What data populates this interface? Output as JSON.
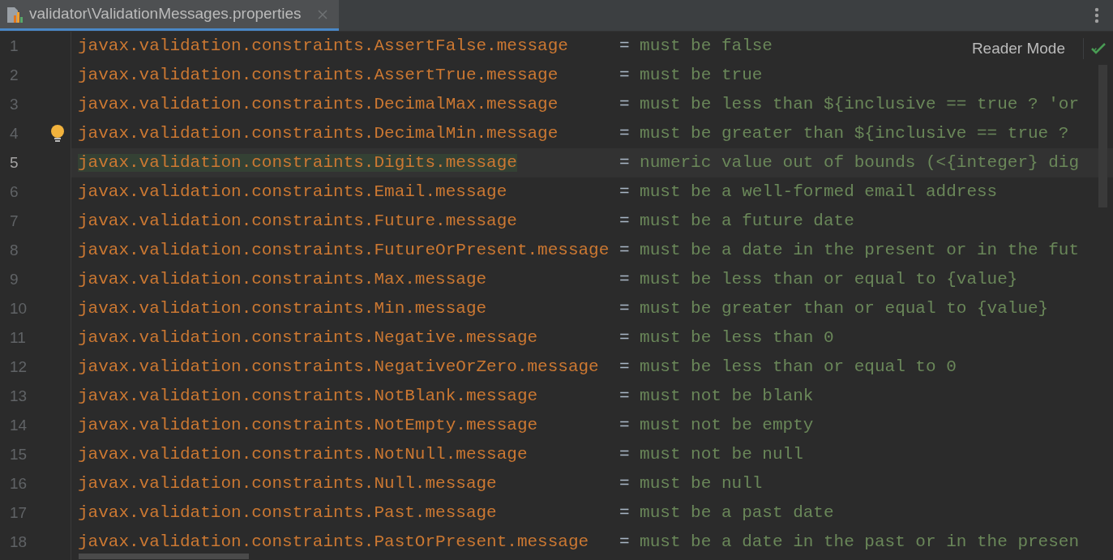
{
  "tab": {
    "title": "validator\\ValidationMessages.properties",
    "selected": true
  },
  "reader_mode": "Reader Mode",
  "lines": [
    {
      "number": "1",
      "key": "javax.validation.constraints.AssertFalse.message",
      "separator": "=",
      "value": "must be false",
      "current": false,
      "bulb": false
    },
    {
      "number": "2",
      "key": "javax.validation.constraints.AssertTrue.message",
      "separator": "=",
      "value": "must be true",
      "current": false,
      "bulb": false
    },
    {
      "number": "3",
      "key": "javax.validation.constraints.DecimalMax.message",
      "separator": "=",
      "value": "must be less than ${inclusive == true ? 'or",
      "current": false,
      "bulb": false
    },
    {
      "number": "4",
      "key": "javax.validation.constraints.DecimalMin.message",
      "separator": "=",
      "value": "must be greater than ${inclusive == true ?",
      "current": false,
      "bulb": true
    },
    {
      "number": "5",
      "key": "javax.validation.constraints.Digits.message",
      "separator": "=",
      "value": "numeric value out of bounds (<{integer} dig",
      "current": true,
      "bulb": false
    },
    {
      "number": "6",
      "key": "javax.validation.constraints.Email.message",
      "separator": "=",
      "value": "must be a well-formed email address",
      "current": false,
      "bulb": false
    },
    {
      "number": "7",
      "key": "javax.validation.constraints.Future.message",
      "separator": "=",
      "value": "must be a future date",
      "current": false,
      "bulb": false
    },
    {
      "number": "8",
      "key": "javax.validation.constraints.FutureOrPresent.message",
      "separator": "=",
      "value": "must be a date in the present or in the fut",
      "current": false,
      "bulb": false
    },
    {
      "number": "9",
      "key": "javax.validation.constraints.Max.message",
      "separator": "=",
      "value": "must be less than or equal to {value}",
      "current": false,
      "bulb": false
    },
    {
      "number": "10",
      "key": "javax.validation.constraints.Min.message",
      "separator": "=",
      "value": "must be greater than or equal to {value}",
      "current": false,
      "bulb": false
    },
    {
      "number": "11",
      "key": "javax.validation.constraints.Negative.message",
      "separator": "=",
      "value": "must be less than 0",
      "current": false,
      "bulb": false
    },
    {
      "number": "12",
      "key": "javax.validation.constraints.NegativeOrZero.message",
      "separator": "=",
      "value": "must be less than or equal to 0",
      "current": false,
      "bulb": false
    },
    {
      "number": "13",
      "key": "javax.validation.constraints.NotBlank.message",
      "separator": "=",
      "value": "must not be blank",
      "current": false,
      "bulb": false
    },
    {
      "number": "14",
      "key": "javax.validation.constraints.NotEmpty.message",
      "separator": "=",
      "value": "must not be empty",
      "current": false,
      "bulb": false
    },
    {
      "number": "15",
      "key": "javax.validation.constraints.NotNull.message",
      "separator": "=",
      "value": "must not be null",
      "current": false,
      "bulb": false
    },
    {
      "number": "16",
      "key": "javax.validation.constraints.Null.message",
      "separator": "=",
      "value": "must be null",
      "current": false,
      "bulb": false
    },
    {
      "number": "17",
      "key": "javax.validation.constraints.Past.message",
      "separator": "=",
      "value": "must be a past date",
      "current": false,
      "bulb": false
    },
    {
      "number": "18",
      "key": "javax.validation.constraints.PastOrPresent.message",
      "separator": "=",
      "value": "must be a date in the past or in the presen",
      "current": false,
      "bulb": false
    }
  ]
}
